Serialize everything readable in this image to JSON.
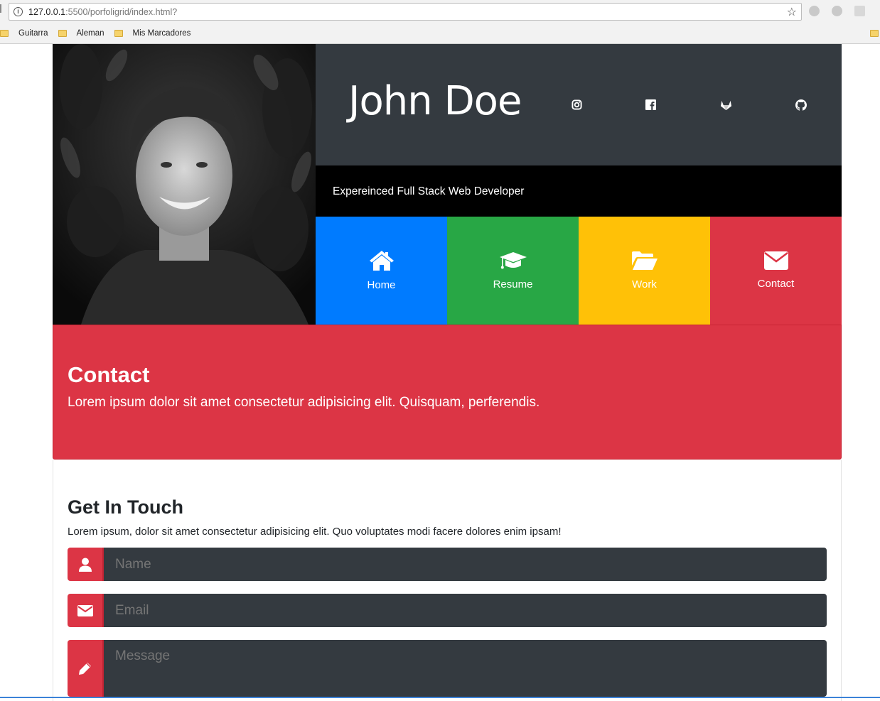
{
  "browser": {
    "url_host": "127.0.0.1",
    "url_path": ":5500/porfoligrid/index.html?",
    "bookmarks": [
      "Guitarra",
      "Aleman",
      "Mis Marcadores"
    ]
  },
  "hero": {
    "name": "John Doe",
    "tagline": "Expereinced Full Stack Web Developer",
    "social_icons": [
      "instagram-icon",
      "facebook-icon",
      "gitlab-icon",
      "github-icon"
    ]
  },
  "nav_tiles": [
    {
      "label": "Home",
      "icon": "home-icon",
      "color": "#007bff"
    },
    {
      "label": "Resume",
      "icon": "graduation-cap-icon",
      "color": "#28a745"
    },
    {
      "label": "Work",
      "icon": "folder-open-icon",
      "color": "#ffc107"
    },
    {
      "label": "Contact",
      "icon": "envelope-icon",
      "color": "#dc3545"
    }
  ],
  "contact": {
    "title": "Contact",
    "subtitle": "Lorem ipsum dolor sit amet consectetur adipisicing elit. Quisquam, perferendis."
  },
  "form": {
    "title": "Get In Touch",
    "subtitle": "Lorem ipsum, dolor sit amet consectetur adipisicing elit. Quo voluptates modi facere dolores enim ipsam!",
    "name_placeholder": "Name",
    "email_placeholder": "Email",
    "message_placeholder": "Message"
  }
}
